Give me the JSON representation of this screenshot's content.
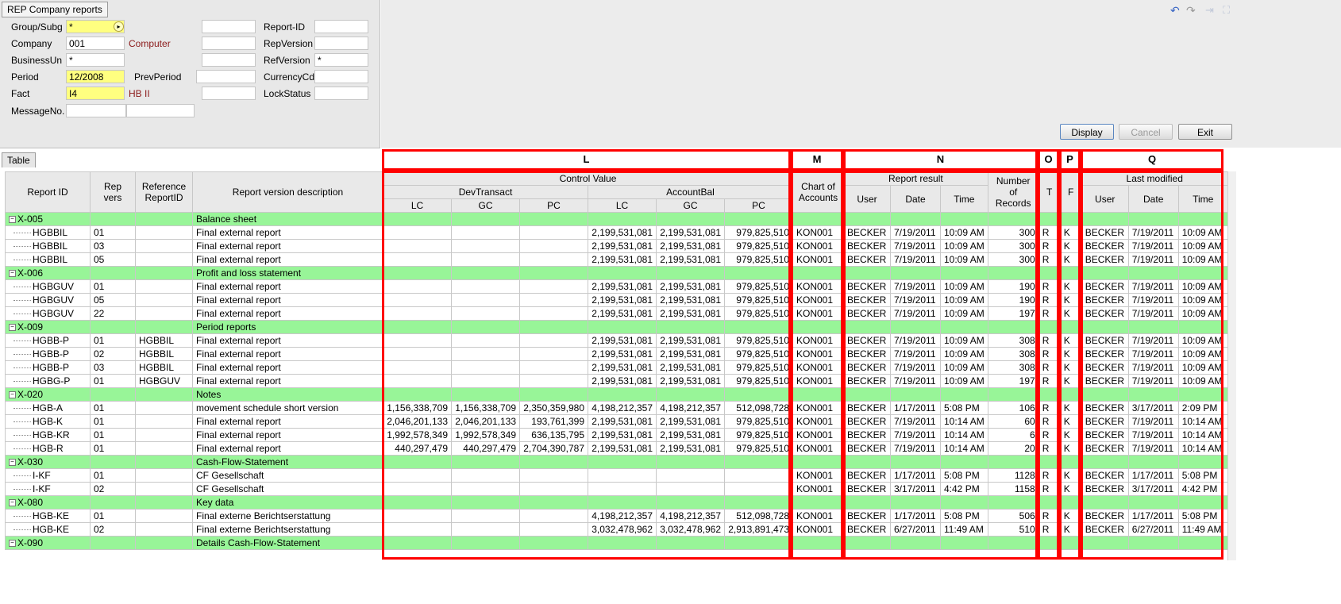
{
  "window_title": "REP Company reports",
  "form": {
    "rows": [
      {
        "label": "Group/Subg",
        "value": "*",
        "desc": ""
      },
      {
        "label": "Company",
        "value": "001",
        "desc": "Computer"
      },
      {
        "label": "BusinessUn",
        "value": "*",
        "desc": ""
      },
      {
        "label": "Period",
        "value": "12/2008",
        "desc": ""
      },
      {
        "label": "Fact",
        "value": "I4",
        "desc": "HB II"
      },
      {
        "label": "MessageNo.",
        "value": "",
        "desc": ""
      }
    ],
    "prev_period_label": "PrevPeriod",
    "right_rows": [
      {
        "label": "Report-ID",
        "value": ""
      },
      {
        "label": "RepVersion",
        "value": ""
      },
      {
        "label": "RefVersion",
        "value": "*"
      },
      {
        "label": "CurrencyCd",
        "value": ""
      },
      {
        "label": "LockStatus",
        "value": ""
      }
    ]
  },
  "buttons": {
    "display": "Display",
    "cancel": "Cancel",
    "exit": "Exit"
  },
  "table_tab": "Table",
  "red_labels": {
    "L": "L",
    "M": "M",
    "N": "N",
    "O": "O",
    "P": "P",
    "Q": "Q"
  },
  "headers": {
    "report_id": "Report ID",
    "rep_vers": "Rep vers",
    "reference": "Reference ReportID",
    "description": "Report version description",
    "control_value": "Control Value",
    "devtransact": "DevTransact",
    "accountbal": "AccountBal",
    "lc": "LC",
    "gc": "GC",
    "pc": "PC",
    "chart": "Chart of Accounts",
    "report_result": "Report result",
    "user": "User",
    "date": "Date",
    "time": "Time",
    "records": "Number of Records",
    "t": "T",
    "f": "F",
    "last_modified": "Last modified"
  },
  "rows": [
    {
      "group": true,
      "id": "X-005",
      "desc": "Balance sheet"
    },
    {
      "id": "HGBBIL",
      "vers": "01",
      "ref": "",
      "desc": "Final external report",
      "d_lc": "",
      "d_gc": "",
      "d_pc": "",
      "a_lc": "2,199,531,081",
      "a_gc": "2,199,531,081",
      "a_pc": "979,825,510",
      "chart": "KON001",
      "r_user": "BECKER",
      "r_date": "7/19/2011",
      "r_time": "10:09 AM",
      "records": "300",
      "t": "R",
      "f": "K",
      "m_user": "BECKER",
      "m_date": "7/19/2011",
      "m_time": "10:09 AM"
    },
    {
      "id": "HGBBIL",
      "vers": "03",
      "ref": "",
      "desc": "Final external report",
      "d_lc": "",
      "d_gc": "",
      "d_pc": "",
      "a_lc": "2,199,531,081",
      "a_gc": "2,199,531,081",
      "a_pc": "979,825,510",
      "chart": "KON001",
      "r_user": "BECKER",
      "r_date": "7/19/2011",
      "r_time": "10:09 AM",
      "records": "300",
      "t": "R",
      "f": "K",
      "m_user": "BECKER",
      "m_date": "7/19/2011",
      "m_time": "10:09 AM"
    },
    {
      "id": "HGBBIL",
      "vers": "05",
      "ref": "",
      "desc": "Final external report",
      "d_lc": "",
      "d_gc": "",
      "d_pc": "",
      "a_lc": "2,199,531,081",
      "a_gc": "2,199,531,081",
      "a_pc": "979,825,510",
      "chart": "KON001",
      "r_user": "BECKER",
      "r_date": "7/19/2011",
      "r_time": "10:09 AM",
      "records": "300",
      "t": "R",
      "f": "K",
      "m_user": "BECKER",
      "m_date": "7/19/2011",
      "m_time": "10:09 AM"
    },
    {
      "group": true,
      "id": "X-006",
      "desc": "Profit and loss statement"
    },
    {
      "id": "HGBGUV",
      "vers": "01",
      "ref": "",
      "desc": "Final external report",
      "d_lc": "",
      "d_gc": "",
      "d_pc": "",
      "a_lc": "2,199,531,081",
      "a_gc": "2,199,531,081",
      "a_pc": "979,825,510",
      "chart": "KON001",
      "r_user": "BECKER",
      "r_date": "7/19/2011",
      "r_time": "10:09 AM",
      "records": "190",
      "t": "R",
      "f": "K",
      "m_user": "BECKER",
      "m_date": "7/19/2011",
      "m_time": "10:09 AM"
    },
    {
      "id": "HGBGUV",
      "vers": "05",
      "ref": "",
      "desc": "Final external report",
      "d_lc": "",
      "d_gc": "",
      "d_pc": "",
      "a_lc": "2,199,531,081",
      "a_gc": "2,199,531,081",
      "a_pc": "979,825,510",
      "chart": "KON001",
      "r_user": "BECKER",
      "r_date": "7/19/2011",
      "r_time": "10:09 AM",
      "records": "190",
      "t": "R",
      "f": "K",
      "m_user": "BECKER",
      "m_date": "7/19/2011",
      "m_time": "10:09 AM"
    },
    {
      "id": "HGBGUV",
      "vers": "22",
      "ref": "",
      "desc": "Final external report",
      "d_lc": "",
      "d_gc": "",
      "d_pc": "",
      "a_lc": "2,199,531,081",
      "a_gc": "2,199,531,081",
      "a_pc": "979,825,510",
      "chart": "KON001",
      "r_user": "BECKER",
      "r_date": "7/19/2011",
      "r_time": "10:09 AM",
      "records": "197",
      "t": "R",
      "f": "K",
      "m_user": "BECKER",
      "m_date": "7/19/2011",
      "m_time": "10:09 AM"
    },
    {
      "group": true,
      "id": "X-009",
      "desc": "Period reports"
    },
    {
      "id": "HGBB-P",
      "vers": "01",
      "ref": "HGBBIL",
      "desc": "Final external report",
      "d_lc": "",
      "d_gc": "",
      "d_pc": "",
      "a_lc": "2,199,531,081",
      "a_gc": "2,199,531,081",
      "a_pc": "979,825,510",
      "chart": "KON001",
      "r_user": "BECKER",
      "r_date": "7/19/2011",
      "r_time": "10:09 AM",
      "records": "308",
      "t": "R",
      "f": "K",
      "m_user": "BECKER",
      "m_date": "7/19/2011",
      "m_time": "10:09 AM"
    },
    {
      "id": "HGBB-P",
      "vers": "02",
      "ref": "HGBBIL",
      "desc": "Final external report",
      "d_lc": "",
      "d_gc": "",
      "d_pc": "",
      "a_lc": "2,199,531,081",
      "a_gc": "2,199,531,081",
      "a_pc": "979,825,510",
      "chart": "KON001",
      "r_user": "BECKER",
      "r_date": "7/19/2011",
      "r_time": "10:09 AM",
      "records": "308",
      "t": "R",
      "f": "K",
      "m_user": "BECKER",
      "m_date": "7/19/2011",
      "m_time": "10:09 AM"
    },
    {
      "id": "HGBB-P",
      "vers": "03",
      "ref": "HGBBIL",
      "desc": "Final external report",
      "d_lc": "",
      "d_gc": "",
      "d_pc": "",
      "a_lc": "2,199,531,081",
      "a_gc": "2,199,531,081",
      "a_pc": "979,825,510",
      "chart": "KON001",
      "r_user": "BECKER",
      "r_date": "7/19/2011",
      "r_time": "10:09 AM",
      "records": "308",
      "t": "R",
      "f": "K",
      "m_user": "BECKER",
      "m_date": "7/19/2011",
      "m_time": "10:09 AM"
    },
    {
      "id": "HGBG-P",
      "vers": "01",
      "ref": "HGBGUV",
      "desc": "Final external report",
      "d_lc": "",
      "d_gc": "",
      "d_pc": "",
      "a_lc": "2,199,531,081",
      "a_gc": "2,199,531,081",
      "a_pc": "979,825,510",
      "chart": "KON001",
      "r_user": "BECKER",
      "r_date": "7/19/2011",
      "r_time": "10:09 AM",
      "records": "197",
      "t": "R",
      "f": "K",
      "m_user": "BECKER",
      "m_date": "7/19/2011",
      "m_time": "10:09 AM"
    },
    {
      "group": true,
      "id": "X-020",
      "desc": "Notes"
    },
    {
      "id": "HGB-A",
      "vers": "01",
      "ref": "",
      "desc": "movement schedule short version",
      "d_lc": "1,156,338,709",
      "d_gc": "1,156,338,709",
      "d_pc": "2,350,359,980",
      "a_lc": "4,198,212,357",
      "a_gc": "4,198,212,357",
      "a_pc": "512,098,728",
      "chart": "KON001",
      "r_user": "BECKER",
      "r_date": "1/17/2011",
      "r_time": "5:08 PM",
      "records": "106",
      "t": "R",
      "f": "K",
      "m_user": "BECKER",
      "m_date": "3/17/2011",
      "m_time": "2:09 PM"
    },
    {
      "id": "HGB-K",
      "vers": "01",
      "ref": "",
      "desc": "Final external report",
      "d_lc": "2,046,201,133",
      "d_gc": "2,046,201,133",
      "d_pc": "193,761,399",
      "a_lc": "2,199,531,081",
      "a_gc": "2,199,531,081",
      "a_pc": "979,825,510",
      "chart": "KON001",
      "r_user": "BECKER",
      "r_date": "7/19/2011",
      "r_time": "10:14 AM",
      "records": "60",
      "t": "R",
      "f": "K",
      "m_user": "BECKER",
      "m_date": "7/19/2011",
      "m_time": "10:14 AM"
    },
    {
      "id": "HGB-KR",
      "vers": "01",
      "ref": "",
      "desc": "Final external report",
      "d_lc": "1,992,578,349",
      "d_gc": "1,992,578,349",
      "d_pc": "636,135,795",
      "a_lc": "2,199,531,081",
      "a_gc": "2,199,531,081",
      "a_pc": "979,825,510",
      "chart": "KON001",
      "r_user": "BECKER",
      "r_date": "7/19/2011",
      "r_time": "10:14 AM",
      "records": "6",
      "t": "R",
      "f": "K",
      "m_user": "BECKER",
      "m_date": "7/19/2011",
      "m_time": "10:14 AM"
    },
    {
      "id": "HGB-R",
      "vers": "01",
      "ref": "",
      "desc": "Final external report",
      "d_lc": "440,297,479",
      "d_gc": "440,297,479",
      "d_pc": "2,704,390,787",
      "a_lc": "2,199,531,081",
      "a_gc": "2,199,531,081",
      "a_pc": "979,825,510",
      "chart": "KON001",
      "r_user": "BECKER",
      "r_date": "7/19/2011",
      "r_time": "10:14 AM",
      "records": "20",
      "t": "R",
      "f": "K",
      "m_user": "BECKER",
      "m_date": "7/19/2011",
      "m_time": "10:14 AM"
    },
    {
      "group": true,
      "id": "X-030",
      "desc": "Cash-Flow-Statement"
    },
    {
      "id": "I-KF",
      "vers": "01",
      "ref": "",
      "desc": "CF Gesellschaft",
      "d_lc": "",
      "d_gc": "",
      "d_pc": "",
      "a_lc": "",
      "a_gc": "",
      "a_pc": "",
      "chart": "KON001",
      "r_user": "BECKER",
      "r_date": "1/17/2011",
      "r_time": "5:08 PM",
      "records": "1128",
      "t": "R",
      "f": "K",
      "m_user": "BECKER",
      "m_date": "1/17/2011",
      "m_time": "5:08 PM"
    },
    {
      "id": "I-KF",
      "vers": "02",
      "ref": "",
      "desc": "CF Gesellschaft",
      "d_lc": "",
      "d_gc": "",
      "d_pc": "",
      "a_lc": "",
      "a_gc": "",
      "a_pc": "",
      "chart": "KON001",
      "r_user": "BECKER",
      "r_date": "3/17/2011",
      "r_time": "4:42 PM",
      "records": "1158",
      "t": "R",
      "f": "K",
      "m_user": "BECKER",
      "m_date": "3/17/2011",
      "m_time": "4:42 PM"
    },
    {
      "group": true,
      "id": "X-080",
      "desc": "Key data"
    },
    {
      "id": "HGB-KE",
      "vers": "01",
      "ref": "",
      "desc": "Final externe Berichtserstattung",
      "d_lc": "",
      "d_gc": "",
      "d_pc": "",
      "a_lc": "4,198,212,357",
      "a_gc": "4,198,212,357",
      "a_pc": "512,098,728",
      "chart": "KON001",
      "r_user": "BECKER",
      "r_date": "1/17/2011",
      "r_time": "5:08 PM",
      "records": "506",
      "t": "R",
      "f": "K",
      "m_user": "BECKER",
      "m_date": "1/17/2011",
      "m_time": "5:08 PM"
    },
    {
      "id": "HGB-KE",
      "vers": "02",
      "ref": "",
      "desc": "Final externe Berichtserstattung",
      "d_lc": "",
      "d_gc": "",
      "d_pc": "",
      "a_lc": "3,032,478,962",
      "a_gc": "3,032,478,962",
      "a_pc": "2,913,891,473",
      "chart": "KON001",
      "r_user": "BECKER",
      "r_date": "6/27/2011",
      "r_time": "11:49 AM",
      "records": "510",
      "t": "R",
      "f": "K",
      "m_user": "BECKER",
      "m_date": "6/27/2011",
      "m_time": "11:49 AM"
    },
    {
      "group": true,
      "id": "X-090",
      "desc": "Details Cash-Flow-Statement"
    }
  ]
}
